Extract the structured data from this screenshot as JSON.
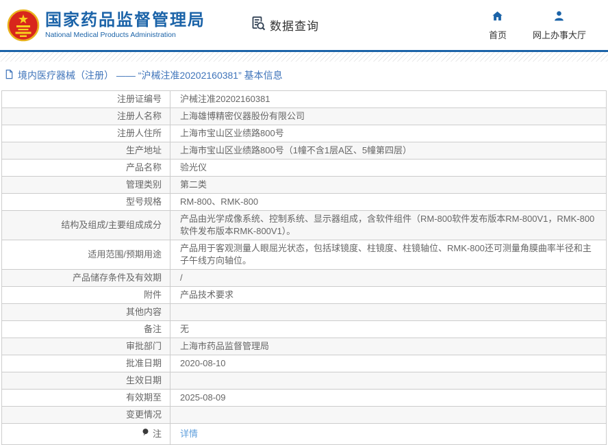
{
  "header": {
    "brand": {
      "emblem_icon": "national-emblem-icon",
      "title_cn": "国家药品监督管理局",
      "title_en": "National Medical Products Administration"
    },
    "query_nav": {
      "icon": "document-search-icon",
      "label": "数据查询"
    },
    "nav_links": [
      {
        "icon": "home-icon",
        "label": "首页"
      },
      {
        "icon": "person-icon",
        "label": "网上办事大厅"
      }
    ],
    "colors": {
      "brand_blue": "#1b63a8",
      "text_dark": "#333333"
    }
  },
  "breadcrumb": {
    "icon": "document-icon",
    "text": "境内医疗器械（注册） —— “沪械注准20202160381” 基本信息"
  },
  "table": {
    "rows": [
      {
        "label": "注册证编号",
        "value": "沪械注准20202160381"
      },
      {
        "label": "注册人名称",
        "value": "上海雄博精密仪器股份有限公司"
      },
      {
        "label": "注册人住所",
        "value": "上海市宝山区业绩路800号"
      },
      {
        "label": "生产地址",
        "value": "上海市宝山区业绩路800号（1幢不含1层A区、5幢第四层）"
      },
      {
        "label": "产品名称",
        "value": "验光仪"
      },
      {
        "label": "管理类别",
        "value": "第二类"
      },
      {
        "label": "型号规格",
        "value": "RM-800、RMK-800"
      },
      {
        "label": "结构及组成/主要组成成分",
        "value": "产品由光学成像系统、控制系统、显示器组成，含软件组件（RM-800软件发布版本RM-800V1，RMK-800软件发布版本RMK-800V1）。"
      },
      {
        "label": "适用范围/预期用途",
        "value": "产品用于客观测量人眼屈光状态，包括球镜度、柱镜度、柱镜轴位、RMK-800还可测量角膜曲率半径和主子午线方向轴位。"
      },
      {
        "label": "产品储存条件及有效期",
        "value": "/"
      },
      {
        "label": "附件",
        "value": "产品技术要求"
      },
      {
        "label": "其他内容",
        "value": ""
      },
      {
        "label": "备注",
        "value": "无"
      },
      {
        "label": "审批部门",
        "value": "上海市药品监督管理局"
      },
      {
        "label": "批准日期",
        "value": "2020-08-10"
      },
      {
        "label": "生效日期",
        "value": ""
      },
      {
        "label": "有效期至",
        "value": "2025-08-09"
      },
      {
        "label": "变更情况",
        "value": ""
      },
      {
        "label": "注",
        "value": "详情",
        "value_is_link": true,
        "label_icon": "bulb-icon"
      }
    ],
    "colors": {
      "border": "#cccccc",
      "alt_row_bg": "#f7f7f7",
      "text": "#666666",
      "link": "#5f9fdc"
    }
  }
}
